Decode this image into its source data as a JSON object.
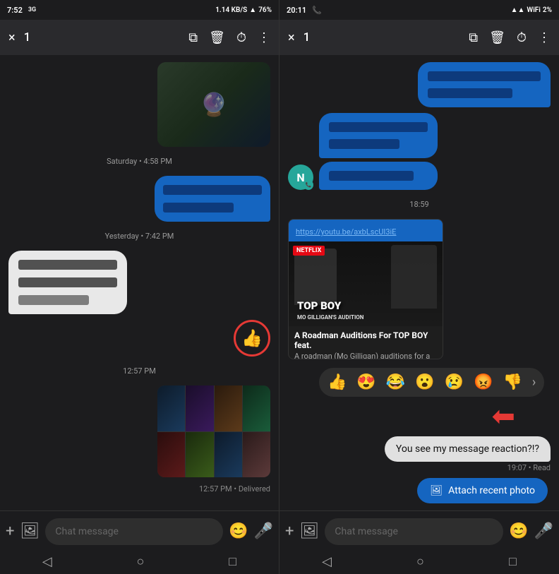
{
  "left": {
    "status_bar": {
      "time": "7:52",
      "signal": "3G",
      "data": "1.14 KB/S",
      "wifi": "WiFi",
      "battery": "76%"
    },
    "top_bar": {
      "close_label": "×",
      "count": "1"
    },
    "timestamp1": "Saturday • 4:58 PM",
    "timestamp2": "Yesterday • 7:42 PM",
    "timestamp3": "12:57 PM",
    "delivered_label": "12:57 PM • Delivered",
    "input_placeholder": "Chat message"
  },
  "right": {
    "status_bar": {
      "time": "20:11",
      "battery": "2%"
    },
    "top_bar": {
      "close_label": "×",
      "count": "1"
    },
    "timestamp1": "18:59",
    "youtube_link": "https://youtu.be/axbLscUI3iE",
    "netflix_label": "NETFLIX",
    "top_boy_title": "TOP BOY",
    "top_boy_subtitle": "MO GILLIGAN'S AUDITION",
    "card_title": "A Roadman Auditions For TOP BOY feat.",
    "card_desc": "A roadman (Mo Gilligan) auditions for a role in TOP BOY ... much to the dismay",
    "reaction_message": "You see my message reaction?!?",
    "reaction_time": "19:07 • Read",
    "attach_btn_label": "Attach recent photo",
    "input_placeholder": "Chat message",
    "avatar_letter": "N"
  },
  "icons": {
    "close": "×",
    "copy": "⧉",
    "trash": "🗑",
    "timer": "⏱",
    "more": "⋮",
    "plus": "+",
    "gallery": "🖼",
    "emoji": "😊",
    "mic": "🎤",
    "back": "◁",
    "home": "○",
    "square": "□",
    "image_attach": "🖼"
  }
}
